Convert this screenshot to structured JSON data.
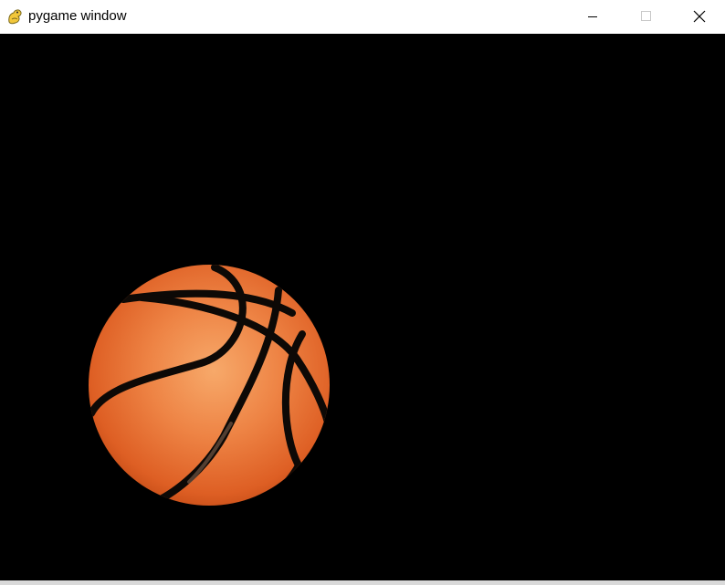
{
  "window": {
    "title": "pygame window",
    "icon": "pygame-snake-icon",
    "controls": {
      "minimize_icon": "minimize-icon",
      "maximize_icon": "maximize-icon",
      "close_icon": "close-icon"
    }
  },
  "canvas": {
    "background_color": "#000000",
    "sprite": "basketball",
    "ball_color": "#e8743a",
    "seam_color": "#0d0906"
  }
}
